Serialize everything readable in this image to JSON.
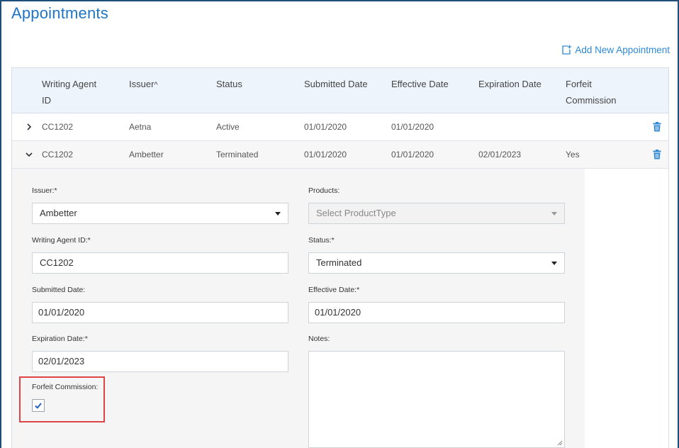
{
  "page": {
    "title": "Appointments",
    "add_link": "Add New Appointment",
    "accent_color": "#1f74c6"
  },
  "table": {
    "headers": {
      "writing_agent_id_line1": "Writing Agent",
      "writing_agent_id_line2": "ID",
      "issuer": "Issuer",
      "issuer_sort": "^",
      "status": "Status",
      "submitted_date": "Submitted Date",
      "effective_date": "Effective Date",
      "expiration_date": "Expiration Date",
      "forfeit_line1": "Forfeit",
      "forfeit_line2": "Commission"
    },
    "rows": [
      {
        "writing_agent_id": "CC1202",
        "issuer": "Aetna",
        "status": "Active",
        "submitted_date": "01/01/2020",
        "effective_date": "01/01/2020",
        "expiration_date": "",
        "forfeit_commission": ""
      },
      {
        "writing_agent_id": "CC1202",
        "issuer": "Ambetter",
        "status": "Terminated",
        "submitted_date": "01/01/2020",
        "effective_date": "01/01/2020",
        "expiration_date": "02/01/2023",
        "forfeit_commission": "Yes"
      }
    ]
  },
  "form": {
    "issuer_label": "Issuer:*",
    "issuer_value": "Ambetter",
    "products_label": "Products:",
    "products_placeholder": "Select ProductType",
    "writing_agent_label": "Writing Agent ID:*",
    "writing_agent_value": "CC1202",
    "status_label": "Status:*",
    "status_value": "Terminated",
    "submitted_label": "Submitted Date:",
    "submitted_value": "01/01/2020",
    "effective_label": "Effective Date:*",
    "effective_value": "01/01/2020",
    "expiration_label": "Expiration Date:*",
    "expiration_value": "02/01/2023",
    "notes_label": "Notes:",
    "forfeit_label": "Forfeit Commission:",
    "forfeit_checked": true
  },
  "icons": {
    "add": "add-document-icon",
    "expand": "chevron-right-icon",
    "collapse": "chevron-down-icon",
    "delete": "trash-icon",
    "check": "checkmark-icon"
  }
}
